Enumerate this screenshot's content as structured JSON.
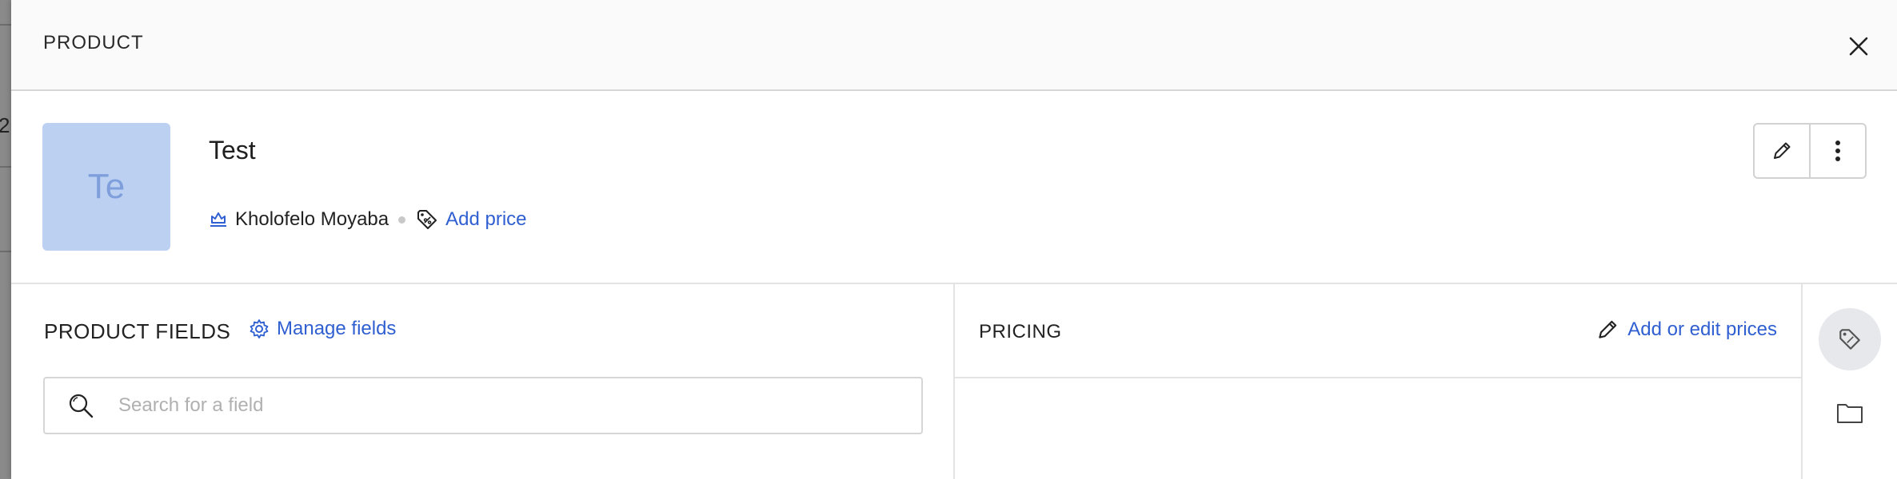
{
  "backdrop": {
    "fragment": "2"
  },
  "panel": {
    "title": "PRODUCT"
  },
  "product": {
    "avatar_initials": "Te",
    "name": "Test",
    "owner": "Kholofelo Moyaba",
    "add_price_label": "Add price"
  },
  "fields": {
    "title": "PRODUCT FIELDS",
    "manage_label": "Manage fields",
    "search_placeholder": "Search for a field"
  },
  "pricing": {
    "title": "PRICING",
    "edit_label": "Add or edit prices"
  },
  "icons": {
    "close": "close-icon",
    "edit": "pencil-icon",
    "more": "kebab-icon",
    "owner": "crown-icon",
    "price": "price-tag-icon",
    "settings": "gear-icon",
    "search": "search-icon",
    "folder": "folder-icon"
  },
  "colors": {
    "link": "#2f5fd0",
    "avatar_bg": "#bcd1f2",
    "avatar_text": "#7f9fdc"
  }
}
